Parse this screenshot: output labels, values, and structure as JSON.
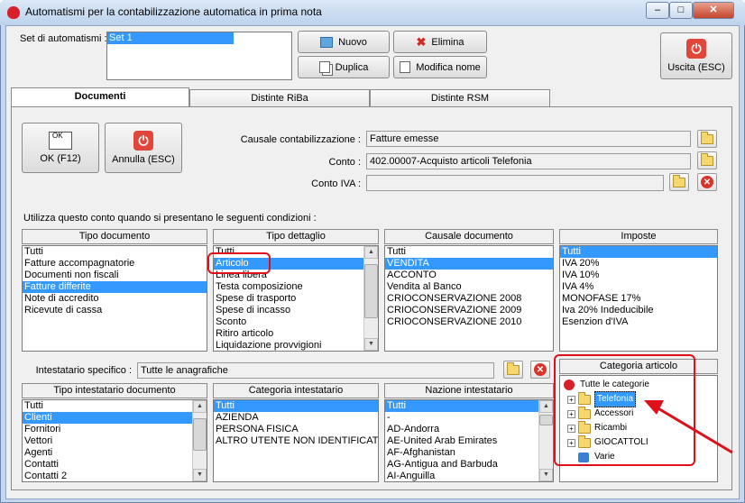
{
  "window": {
    "title": "Automatismi per la contabilizzazione automatica in prima nota"
  },
  "caption": {
    "minimize": "–",
    "maximize": "□",
    "close": "✕"
  },
  "set": {
    "label": "Set di automatismi :",
    "items": [
      "Set 1"
    ],
    "nuovo": "Nuovo",
    "elimina": "Elimina",
    "duplica": "Duplica",
    "modifica": "Modifica nome",
    "uscita": "Uscita (ESC)"
  },
  "tabs": [
    "Documenti",
    "Distinte RiBa",
    "Distinte RSM"
  ],
  "doc": {
    "ok": "OK (F12)",
    "ok_icon_text": "OK",
    "annulla": "Annulla (ESC)",
    "causale_label": "Causale contabilizzazione :",
    "causale_value": "Fatture emesse",
    "conto_label": "Conto :",
    "conto_value": "402.00007-Acquisto articoli Telefonia",
    "contoiva_label": "Conto IVA :",
    "contoiva_value": "",
    "condizioni": "Utilizza questo conto quando si presentano le seguenti condizioni :"
  },
  "tipo_documento": {
    "header": "Tipo documento",
    "items": [
      "Tutti",
      "Fatture accompagnatorie",
      "Documenti non fiscali",
      "Fatture differite",
      "Note di accredito",
      "Ricevute di cassa"
    ],
    "selected": 3
  },
  "tipo_dettaglio": {
    "header": "Tipo dettaglio",
    "items": [
      "Tutti",
      "Articolo",
      "Linea libera",
      "Testa composizione",
      "Spese di trasporto",
      "Spese di incasso",
      "Sconto",
      "Ritiro articolo",
      "Liquidazione provvigioni"
    ],
    "selected": 1
  },
  "causale_documento": {
    "header": "Causale documento",
    "items": [
      "Tutti",
      "VENDITA",
      "ACCONTO",
      "Vendita al Banco",
      "CRIOCONSERVAZIONE 2008",
      "CRIOCONSERVAZIONE 2009",
      "CRIOCONSERVAZIONE 2010"
    ],
    "selected": 1
  },
  "imposte": {
    "header": "Imposte",
    "items": [
      "Tutti",
      "IVA 20%",
      "IVA 10%",
      "IVA 4%",
      "MONOFASE 17%",
      "Iva 20% Indeducibile",
      "Esenzion d'IVA"
    ],
    "selected": 0
  },
  "intestatario": {
    "label": "Intestatario specifico :",
    "value": "Tutte le anagrafiche"
  },
  "tipo_intestatario": {
    "header": "Tipo intestatario documento",
    "items": [
      "Tutti",
      "Clienti",
      "Fornitori",
      "Vettori",
      "Agenti",
      "Contatti",
      "Contatti 2"
    ],
    "selected": 1
  },
  "categoria_intestatario": {
    "header": "Categoria intestatario",
    "items": [
      "Tutti",
      "AZIENDA",
      "PERSONA FISICA",
      "ALTRO UTENTE NON IDENTIFICAT"
    ],
    "selected": 0
  },
  "nazione": {
    "header": "Nazione intestatario",
    "items": [
      "Tutti",
      "-",
      "AD-Andorra",
      "AE-United Arab Emirates",
      "AF-Afghanistan",
      "AG-Antigua and Barbuda",
      "AI-Anguilla"
    ],
    "selected": 0
  },
  "categoria_articolo": {
    "header": "Categoria articolo",
    "root": "Tutte le categorie",
    "nodes": [
      "Telefonia",
      "Accessori",
      "Ricambi",
      "GIOCATTOLI",
      "Varie"
    ],
    "selected": 0
  },
  "colors": {
    "selection": "#3399ff",
    "highlight": "#e0101a"
  }
}
